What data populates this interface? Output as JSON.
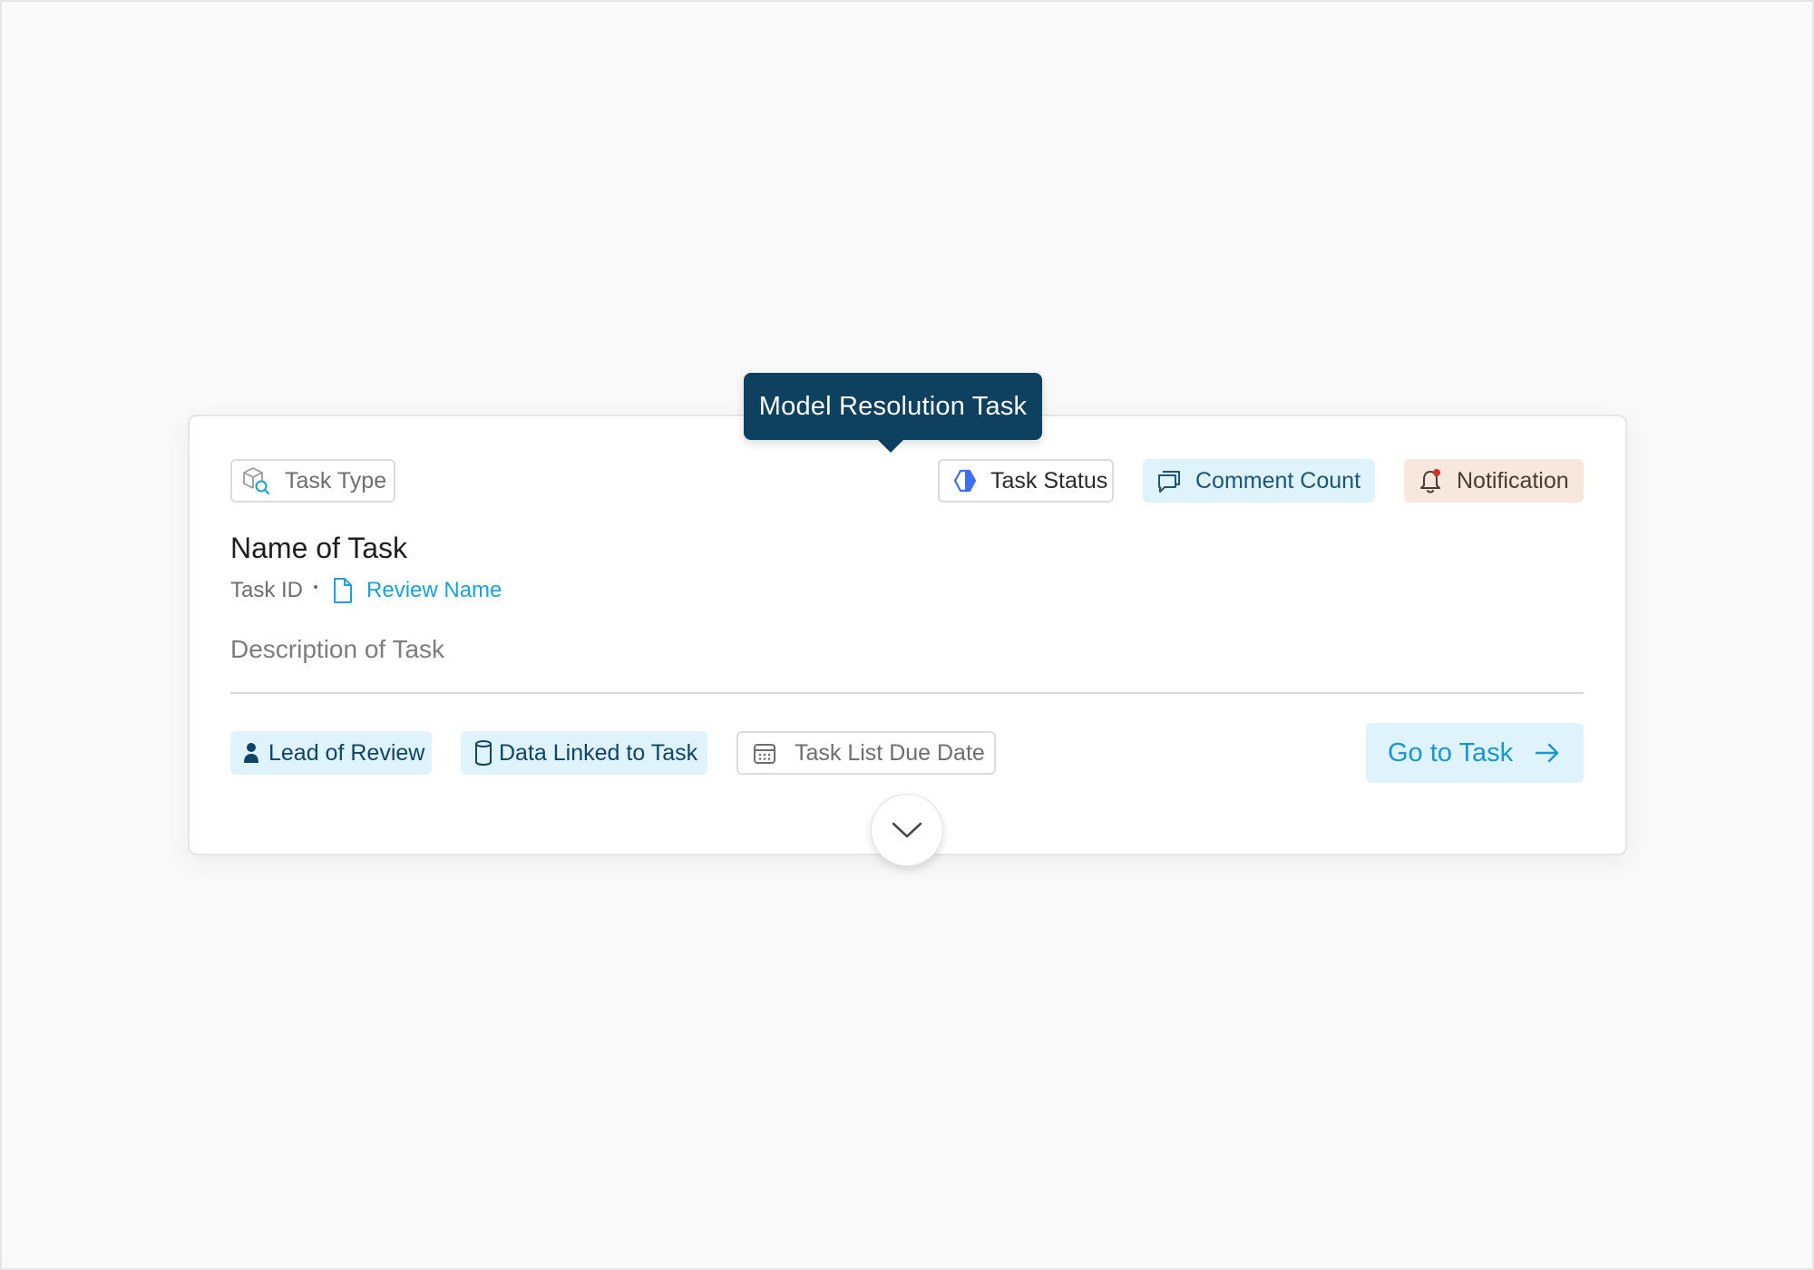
{
  "tooltip": {
    "text": "Model Resolution Task"
  },
  "card": {
    "task_type": {
      "label": "Task Type",
      "icon": "cube-search-icon"
    },
    "task_status": {
      "label": "Task Status",
      "icon": "half-circle-status-icon",
      "accent": "#3b6ef5"
    },
    "comment_count": {
      "label": "Comment Count",
      "icon": "chat-bubbles-icon"
    },
    "notification": {
      "label": "Notification",
      "icon": "bell-icon",
      "indicator_color": "#d0312d"
    },
    "title": "Name of Task",
    "task_id": "Task ID",
    "review_name": "Review Name",
    "description": "Description of Task",
    "lead": {
      "label": "Lead of Review",
      "icon": "person-icon"
    },
    "data_linked": {
      "label": "Data Linked to Task",
      "icon": "database-icon"
    },
    "due_date": {
      "label": "Task List Due Date",
      "icon": "calendar-icon"
    },
    "go_button": {
      "label": "Go to Task",
      "icon": "arrow-right-icon"
    },
    "expand": {
      "icon": "chevron-down-icon"
    }
  },
  "colors": {
    "tooltip_bg": "#0e4060",
    "chip_blue_bg": "#dff3fd",
    "chip_peach_bg": "#f7e7dd",
    "link": "#1aa0dc"
  }
}
